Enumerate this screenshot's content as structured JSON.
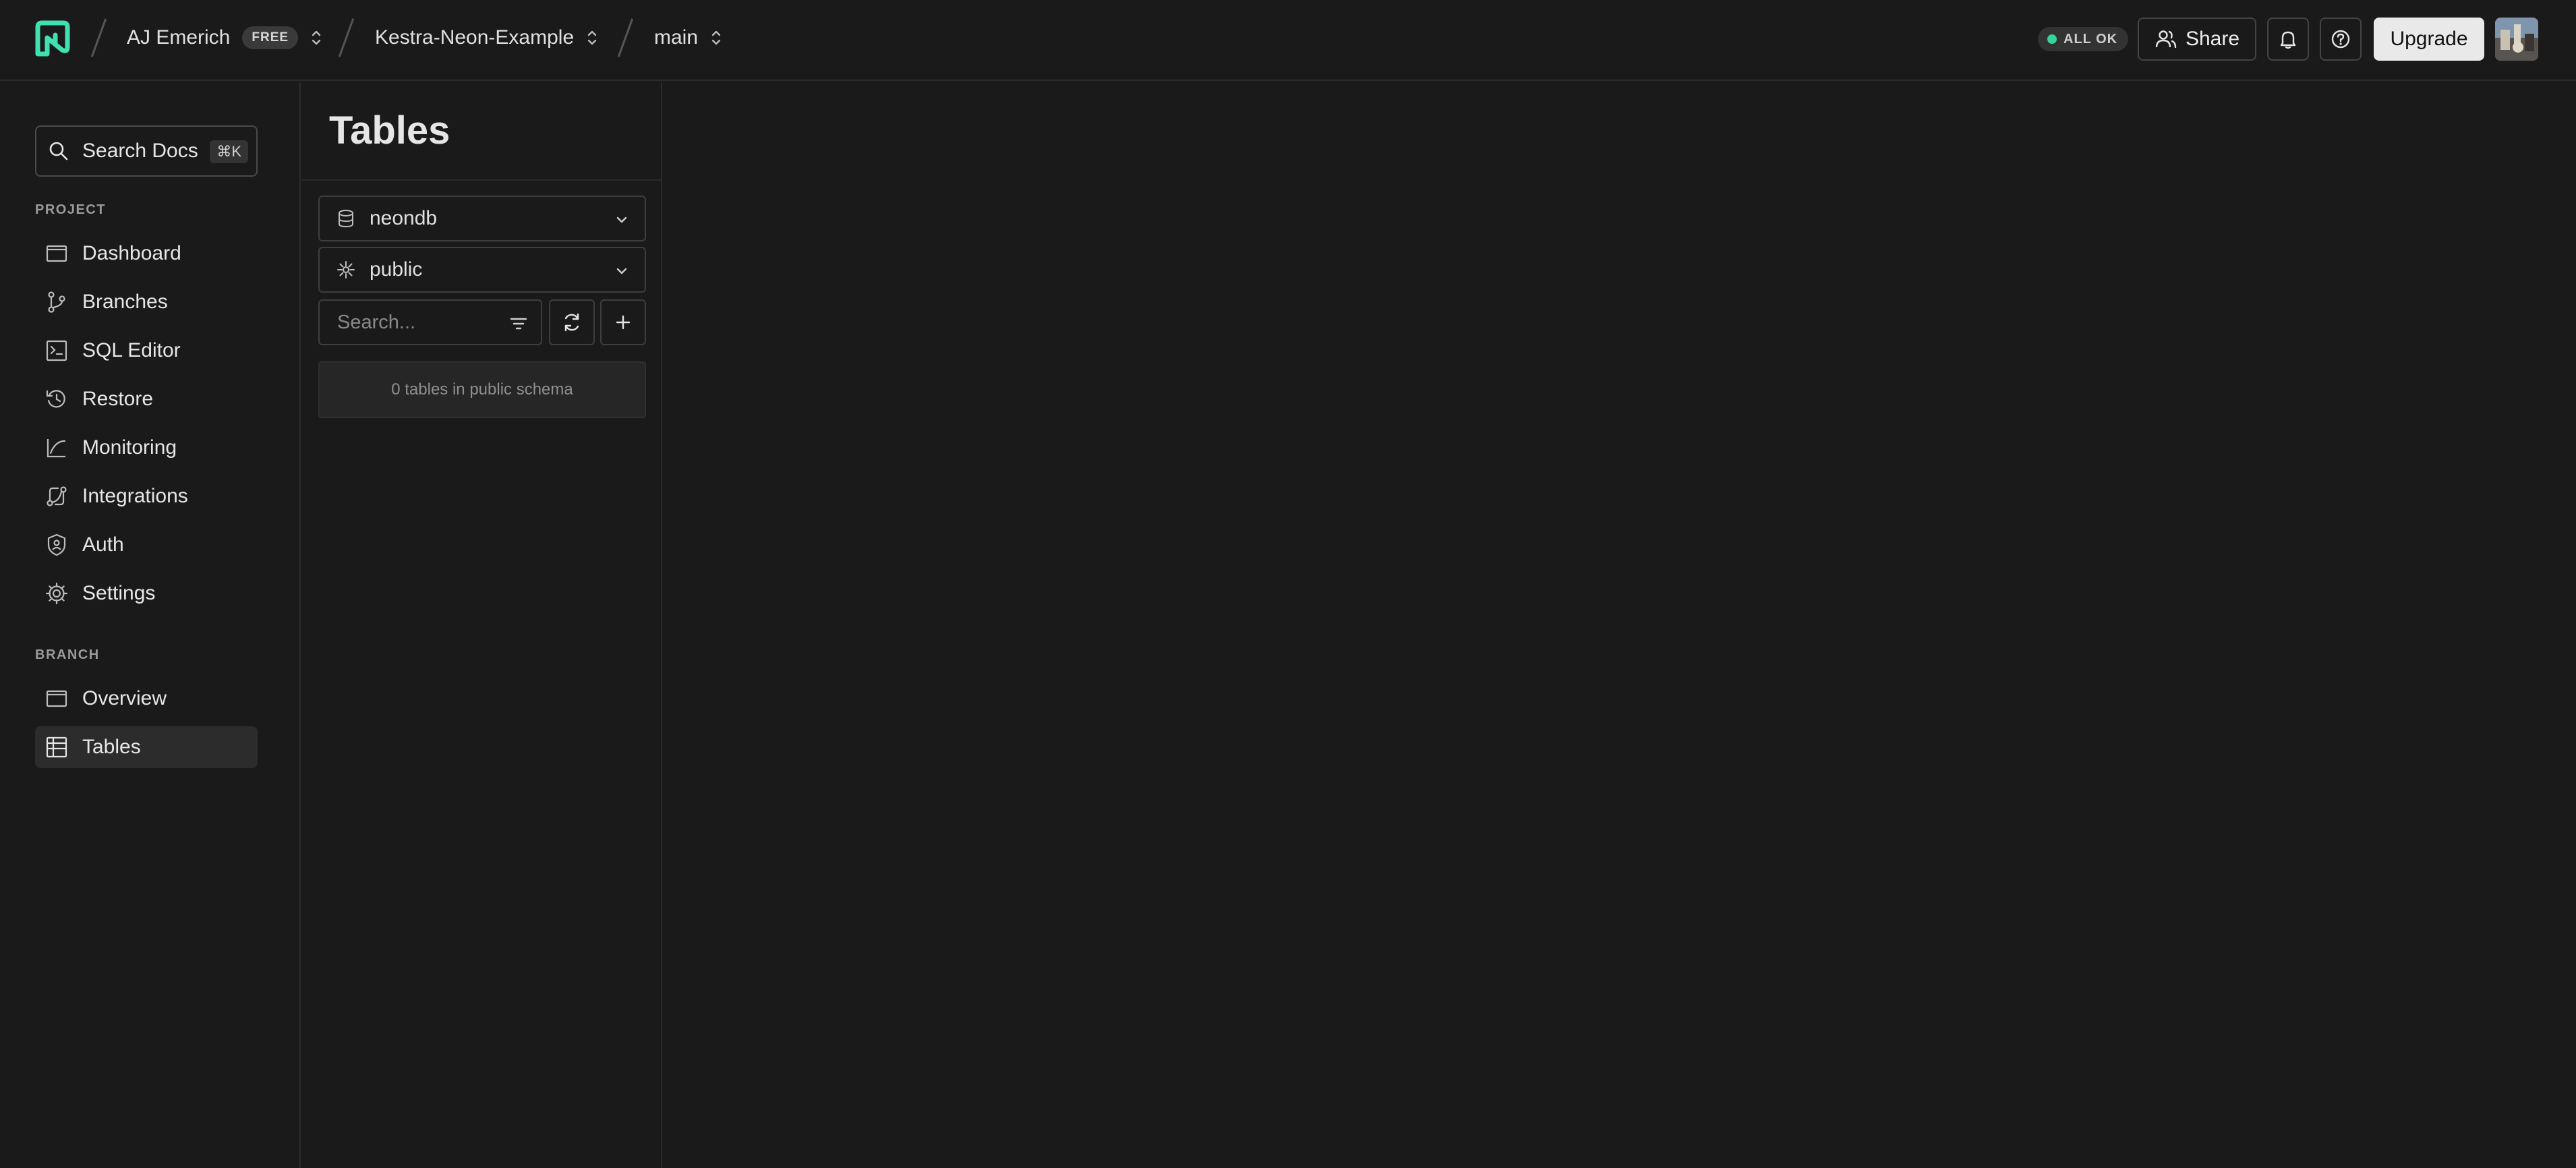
{
  "header": {
    "org": {
      "name": "AJ Emerich",
      "plan_badge": "FREE"
    },
    "project": {
      "name": "Kestra-Neon-Example"
    },
    "branch": {
      "name": "main"
    },
    "status": {
      "label": "ALL OK",
      "color": "#34d59a"
    },
    "share_label": "Share",
    "upgrade_label": "Upgrade",
    "icons": [
      "neon-logo-icon",
      "bell-icon",
      "help-icon",
      "users-icon"
    ]
  },
  "sidebar": {
    "search": {
      "label": "Search Docs",
      "shortcut": "⌘K"
    },
    "project_section": "PROJECT",
    "project_items": [
      {
        "label": "Dashboard",
        "icon": "dashboard-icon"
      },
      {
        "label": "Branches",
        "icon": "branches-icon"
      },
      {
        "label": "SQL Editor",
        "icon": "sql-editor-icon"
      },
      {
        "label": "Restore",
        "icon": "restore-icon"
      },
      {
        "label": "Monitoring",
        "icon": "monitoring-icon"
      },
      {
        "label": "Integrations",
        "icon": "integrations-icon"
      },
      {
        "label": "Auth",
        "icon": "auth-icon"
      },
      {
        "label": "Settings",
        "icon": "gear-icon"
      }
    ],
    "branch_section": "BRANCH",
    "branch_items": [
      {
        "label": "Overview",
        "icon": "overview-icon"
      },
      {
        "label": "Tables",
        "icon": "tables-icon",
        "active": true
      }
    ]
  },
  "tables_panel": {
    "title": "Tables",
    "database": "neondb",
    "schema": "public",
    "search_placeholder": "Search...",
    "empty_message": "0 tables in public schema"
  }
}
